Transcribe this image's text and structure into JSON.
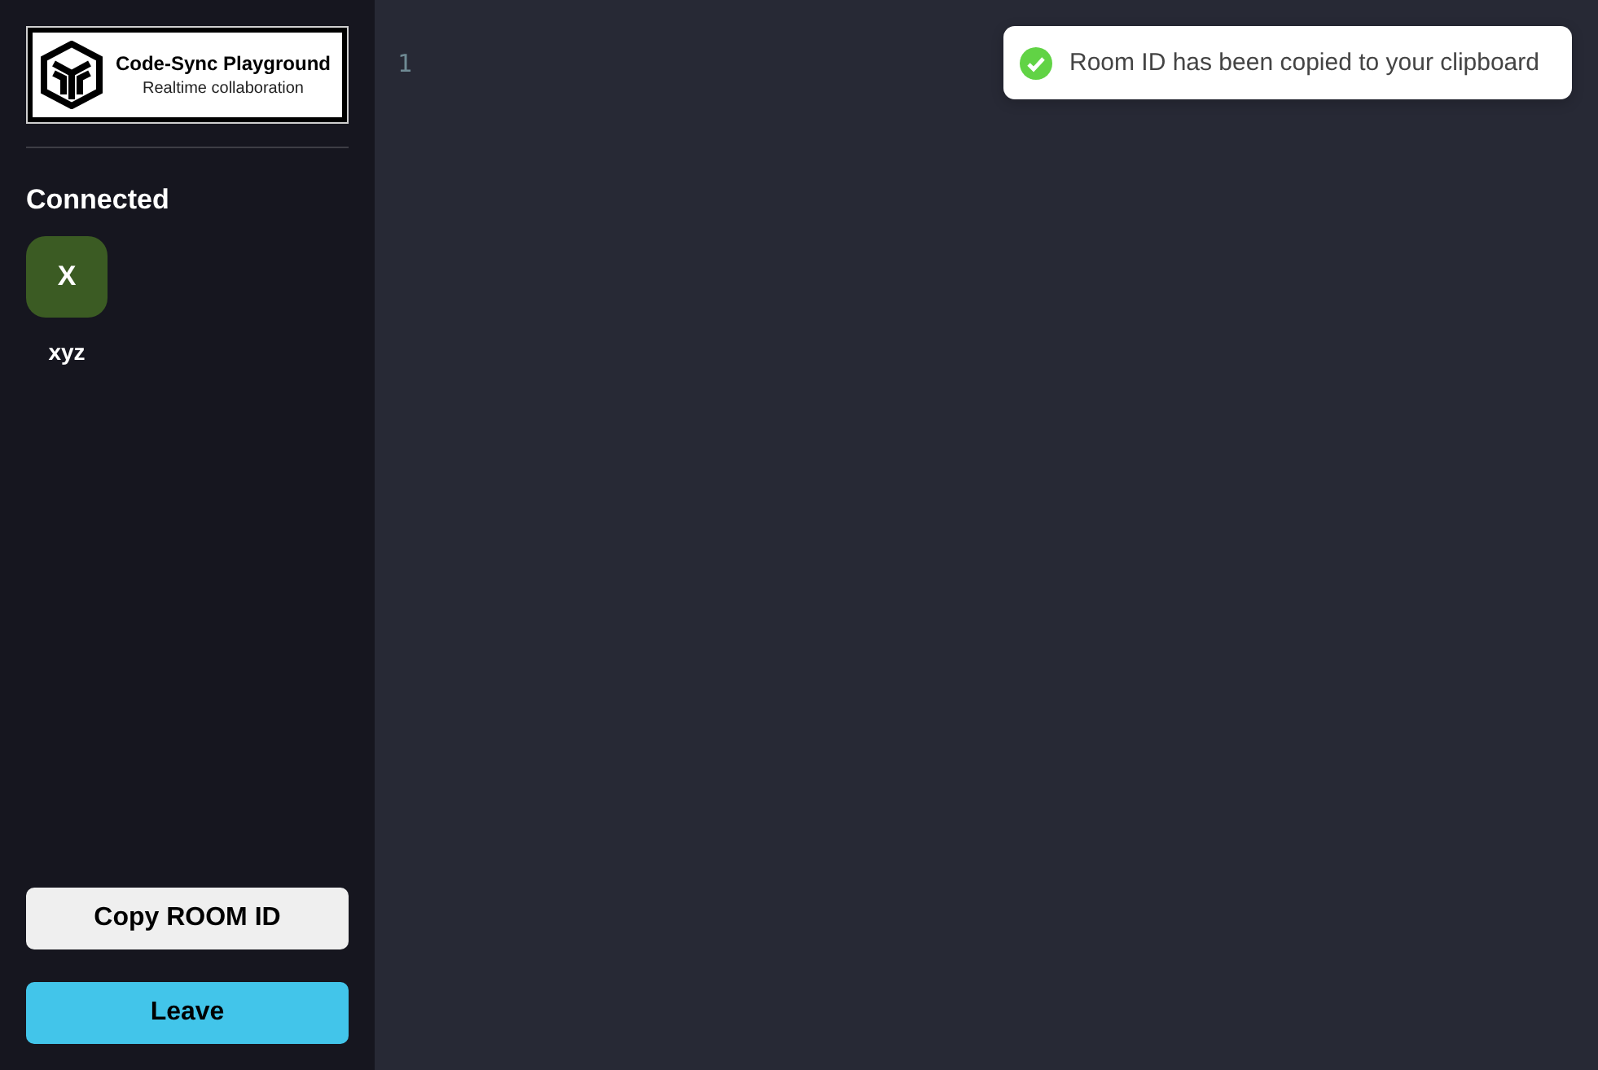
{
  "logo": {
    "title": "Code-Sync Playground",
    "subtitle": "Realtime collaboration"
  },
  "connected": {
    "heading": "Connected",
    "clients": [
      {
        "initial": "X",
        "name": "xyz",
        "color": "#3b5b23"
      }
    ]
  },
  "buttons": [
    {
      "label": "Copy ROOM ID",
      "kind": "secondary"
    },
    {
      "label": "Leave",
      "kind": "primary"
    }
  ],
  "editor": {
    "line_numbers": [
      "1"
    ]
  },
  "toast": {
    "message": "Room ID has been copied to your clipboard",
    "kind": "success"
  }
}
